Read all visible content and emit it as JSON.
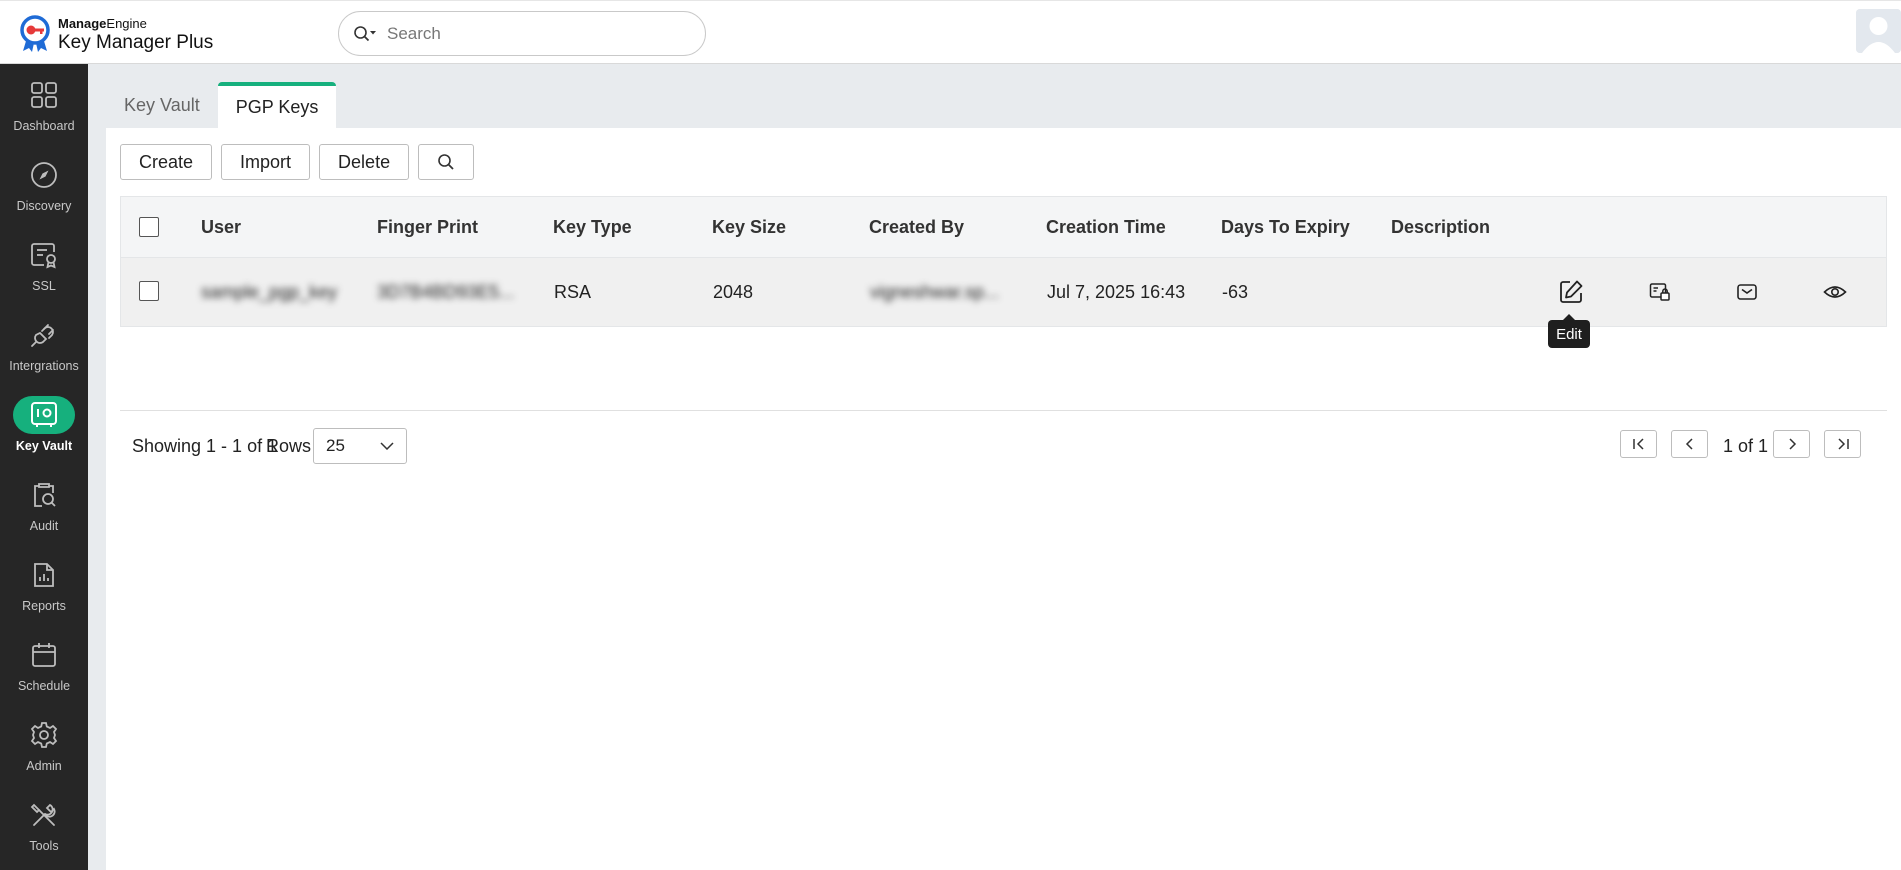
{
  "app": {
    "brand_prefix": "Manage",
    "brand_suffix": "Engine",
    "product": "Key Manager Plus"
  },
  "search": {
    "placeholder": "Search"
  },
  "sidebar": {
    "items": [
      {
        "label": "Dashboard",
        "icon": "dashboard-icon"
      },
      {
        "label": "Discovery",
        "icon": "compass-icon"
      },
      {
        "label": "SSL",
        "icon": "certificate-icon"
      },
      {
        "label": "Intergrations",
        "icon": "plug-icon"
      },
      {
        "label": "Key Vault",
        "icon": "vault-icon",
        "active": true
      },
      {
        "label": "Audit",
        "icon": "audit-icon"
      },
      {
        "label": "Reports",
        "icon": "reports-icon"
      },
      {
        "label": "Schedule",
        "icon": "calendar-icon"
      },
      {
        "label": "Admin",
        "icon": "gear-icon"
      },
      {
        "label": "Tools",
        "icon": "tools-icon"
      }
    ]
  },
  "tabs": [
    {
      "label": "Key Vault"
    },
    {
      "label": "PGP Keys",
      "active": true
    }
  ],
  "toolbar": {
    "create": "Create",
    "import": "Import",
    "delete": "Delete"
  },
  "table": {
    "headers": {
      "user": "User",
      "fingerprint": "Finger Print",
      "key_type": "Key Type",
      "key_size": "Key Size",
      "created_by": "Created By",
      "creation_time": "Creation Time",
      "days_to_expiry": "Days To Expiry",
      "description": "Description"
    },
    "rows": [
      {
        "user": "sample_pgp_key",
        "fingerprint": "3D7B4BD93E5...",
        "key_type": "RSA",
        "key_size": "2048",
        "created_by": "vigneshwar.sp...",
        "creation_time": "Jul 7, 2025 16:43",
        "days_to_expiry": "-63",
        "description": ""
      }
    ]
  },
  "tooltip": {
    "text": "Edit"
  },
  "pagination": {
    "showing": "Showing 1 - 1 of 1",
    "rows_label": "Rows",
    "rows_value": "25",
    "page_text": "1 of 1"
  },
  "colors": {
    "accent": "#16b07d",
    "sidebar_bg": "#262626"
  }
}
